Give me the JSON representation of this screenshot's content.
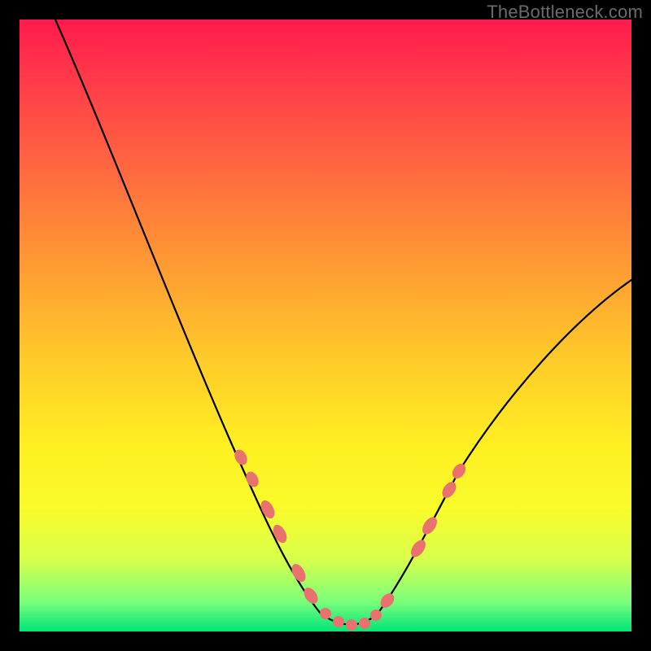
{
  "watermark": "TheBottleneck.com",
  "colors": {
    "gradient_top": "#ff1a4d",
    "gradient_bottom": "#00e57a",
    "curve": "#000000",
    "marker": "#e9726e",
    "frame": "#000000"
  },
  "chart_data": {
    "type": "line",
    "title": "",
    "xlabel": "",
    "ylabel": "",
    "xlim": [
      0,
      100
    ],
    "ylim": [
      0,
      100
    ],
    "grid": false,
    "legend": false,
    "series": [
      {
        "name": "bottleneck-curve",
        "x": [
          0,
          4,
          8,
          12,
          16,
          20,
          24,
          28,
          32,
          36,
          40,
          44,
          48,
          50,
          52,
          54,
          56,
          58,
          60,
          64,
          68,
          72,
          76,
          80,
          84,
          88,
          92,
          96,
          100
        ],
        "y": [
          108,
          100,
          92,
          84,
          76,
          68,
          60,
          52,
          44,
          36,
          28,
          20,
          10,
          5,
          2,
          1,
          1,
          2,
          5,
          12,
          20,
          28,
          35,
          41,
          46,
          50,
          53,
          55,
          57
        ]
      }
    ],
    "markers": {
      "name": "highlighted-points",
      "shape": "pill",
      "x": [
        36,
        38,
        41,
        43,
        46,
        48,
        50,
        52,
        54,
        56,
        58,
        60,
        65,
        67,
        70,
        72
      ],
      "y": [
        28,
        25,
        20,
        16,
        10,
        6,
        4,
        2,
        1,
        1,
        2,
        5,
        14,
        18,
        24,
        28
      ]
    }
  }
}
